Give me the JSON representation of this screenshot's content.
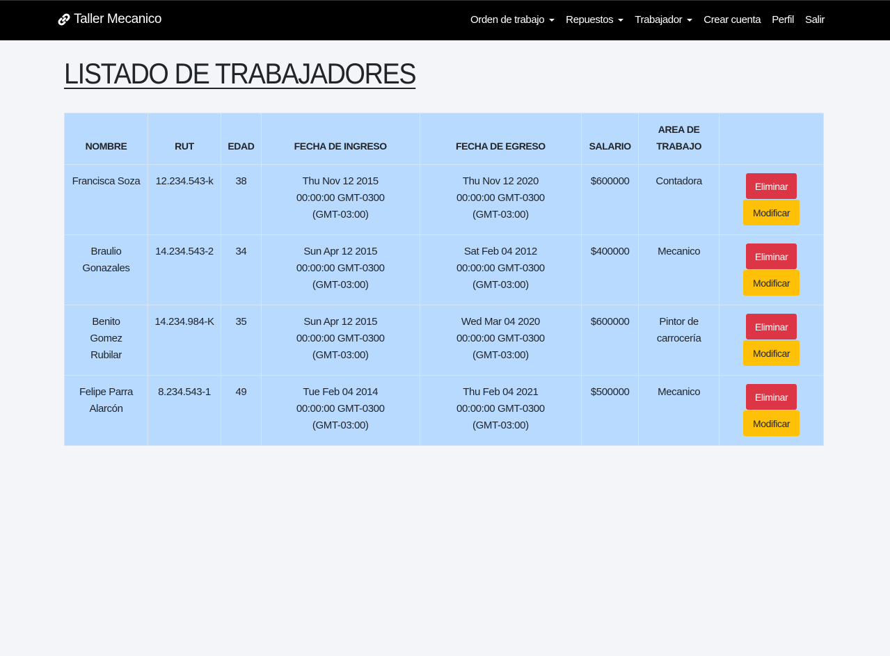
{
  "navbar": {
    "brand": "Taller Mecanico",
    "links": [
      {
        "label": "Orden de trabajo",
        "dropdown": true
      },
      {
        "label": "Repuestos",
        "dropdown": true
      },
      {
        "label": "Trabajador",
        "dropdown": true
      },
      {
        "label": "Crear cuenta",
        "dropdown": false
      },
      {
        "label": "Perfil",
        "dropdown": false
      },
      {
        "label": "Salir",
        "dropdown": false
      }
    ]
  },
  "page": {
    "title": "LISTADO DE TRABAJADORES"
  },
  "table": {
    "headers": [
      "NOMBRE",
      "RUT",
      "EDAD",
      "FECHA DE INGRESO",
      "FECHA DE EGRESO",
      "SALARIO",
      "AREA DE TRABAJO",
      ""
    ],
    "rows": [
      {
        "nombre": "Francisca Soza",
        "rut": "12.234.543-k",
        "edad": "38",
        "ingreso": "Thu Nov 12 2015 00:00:00 GMT-0300 (GMT-03:00)",
        "egreso": "Thu Nov 12 2020 00:00:00 GMT-0300 (GMT-03:00)",
        "salario": "$600000",
        "area": "Contadora"
      },
      {
        "nombre": "Braulio Gonazales",
        "rut": "14.234.543-2",
        "edad": "34",
        "ingreso": "Sun Apr 12 2015 00:00:00 GMT-0300 (GMT-03:00)",
        "egreso": "Sat Feb 04 2012 00:00:00 GMT-0300 (GMT-03:00)",
        "salario": "$400000",
        "area": "Mecanico"
      },
      {
        "nombre": "Benito Gomez Rubilar",
        "rut": "14.234.984-K",
        "edad": "35",
        "ingreso": "Sun Apr 12 2015 00:00:00 GMT-0300 (GMT-03:00)",
        "egreso": "Wed Mar 04 2020 00:00:00 GMT-0300 (GMT-03:00)",
        "salario": "$600000",
        "area": "Pintor de carrocería"
      },
      {
        "nombre": "Felipe Parra Alarcón",
        "rut": "8.234.543-1",
        "edad": "49",
        "ingreso": "Tue Feb 04 2014 00:00:00 GMT-0300 (GMT-03:00)",
        "egreso": "Thu Feb 04 2021 00:00:00 GMT-0300 (GMT-03:00)",
        "salario": "$500000",
        "area": "Mecanico"
      }
    ],
    "delete_label": "Eliminar",
    "edit_label": "Modificar"
  },
  "colors": {
    "navbar_bg": "#000000",
    "table_bg": "#b8daff",
    "danger": "#dc3545",
    "warning": "#ffc107"
  },
  "icons": {
    "brand": "link-icon",
    "dropdown": "caret-down-icon"
  }
}
